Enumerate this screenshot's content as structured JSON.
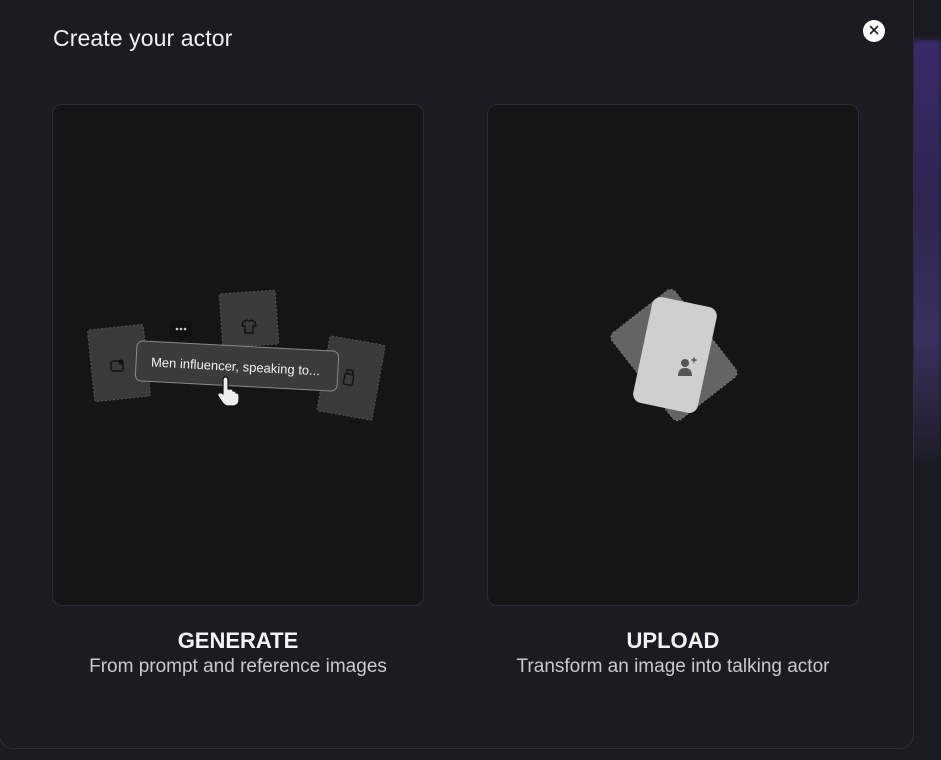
{
  "modal": {
    "title": "Create your actor",
    "close_icon": "close-icon"
  },
  "options": [
    {
      "id": "generate",
      "title": "GENERATE",
      "subtitle": "From prompt and reference images",
      "illustration": {
        "prompt_text": "Men influencer, speaking to...",
        "icons": [
          "chat-icon",
          "image-icon",
          "shirt-icon",
          "bottle-icon",
          "hand-pointer-icon"
        ]
      }
    },
    {
      "id": "upload",
      "title": "UPLOAD",
      "subtitle": "Transform an image into talking actor",
      "illustration": {
        "icons": [
          "add-user-icon"
        ]
      }
    }
  ],
  "colors": {
    "modal_bg": "#1b1c21",
    "card_bg": "#151515",
    "text_primary": "#f4f4f5",
    "text_secondary": "#c9cacd"
  }
}
